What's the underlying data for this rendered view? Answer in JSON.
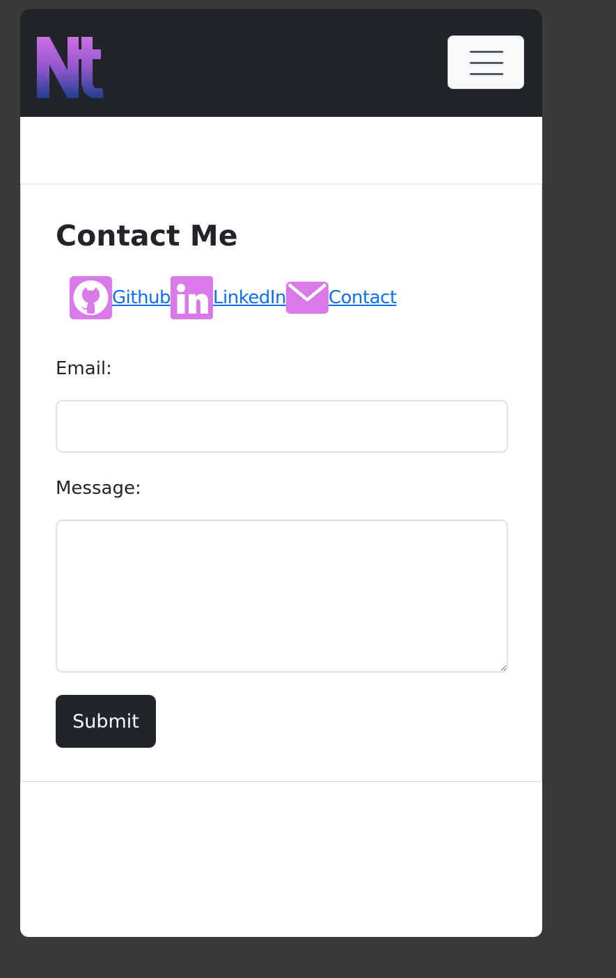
{
  "colors": {
    "page_background": "#3a3a3a",
    "navbar_background": "#212529",
    "icon_tile": "#d97ae8",
    "link": "#0d6efd",
    "logo_gradient_top": "#cf6fe6",
    "logo_gradient_bottom": "#1f3f8f",
    "submit_background": "#212529"
  },
  "navbar": {
    "logo_icon": "nt-logo",
    "toggler_icon": "hamburger-menu-icon"
  },
  "contact": {
    "title": "Contact Me",
    "links": [
      {
        "label": "Github",
        "icon": "github-icon"
      },
      {
        "label": "LinkedIn",
        "icon": "linkedin-icon"
      },
      {
        "label": "Contact",
        "icon": "envelope-icon"
      }
    ],
    "email_label": "Email:",
    "email_value": "",
    "message_label": "Message:",
    "message_value": "",
    "submit_label": "Submit"
  }
}
